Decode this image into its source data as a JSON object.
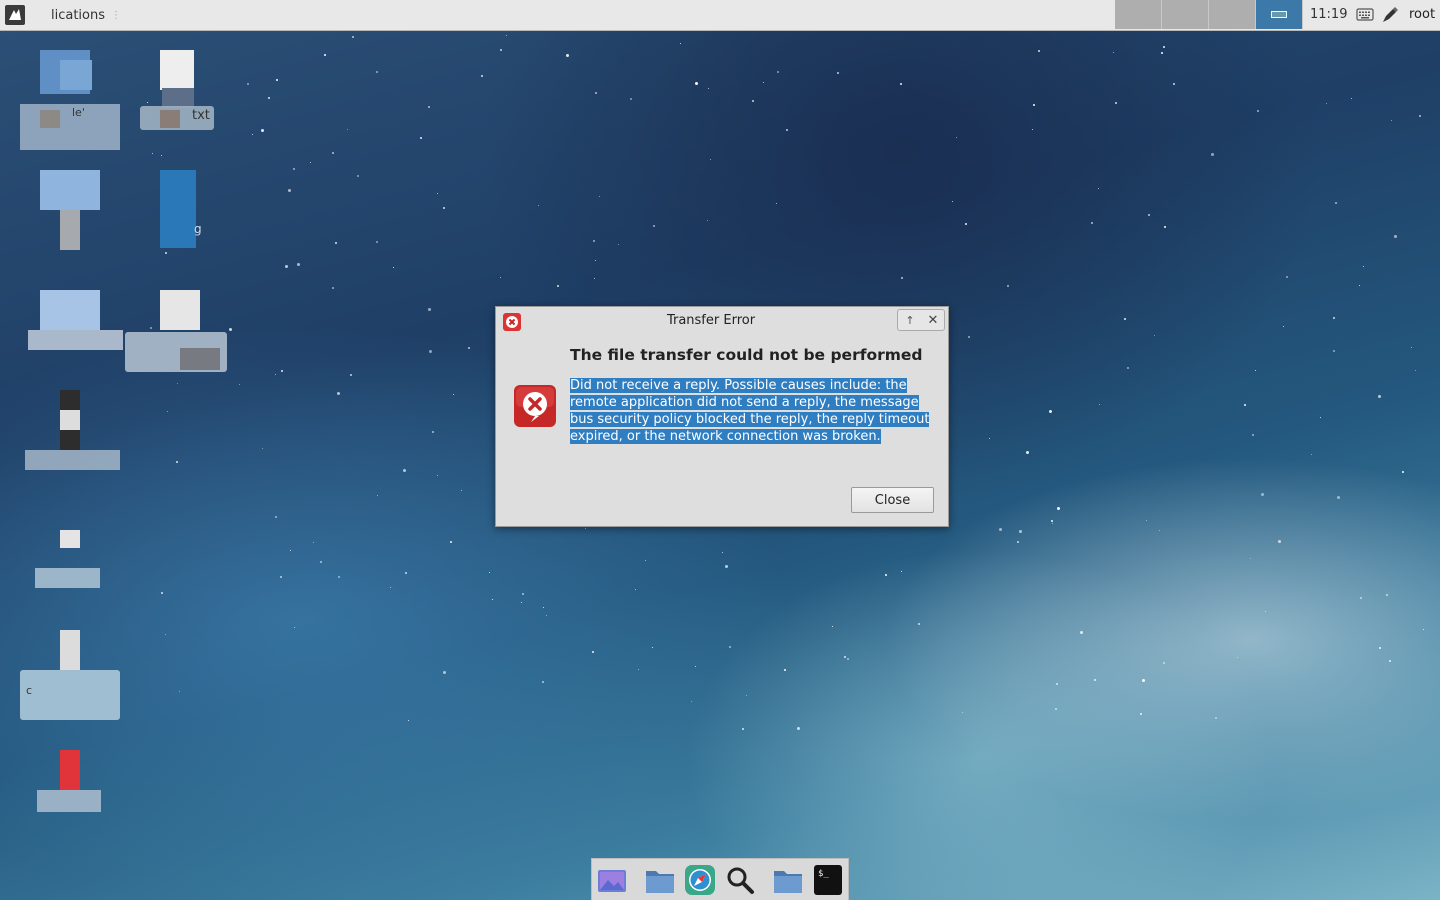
{
  "panel": {
    "applications_label": "lications",
    "separator": "⋮",
    "clock": "11:19",
    "user": "root",
    "workspace_count": 4,
    "active_workspace": 4
  },
  "desktop": {
    "icons": [
      {
        "icon": "folder-link-icon",
        "label": "le'"
      },
      {
        "icon": "text-file-icon",
        "label": "txt"
      },
      {
        "icon": "file-icon",
        "label": ""
      },
      {
        "icon": "image-file-icon",
        "label": "g"
      },
      {
        "icon": "file-icon",
        "label": ""
      },
      {
        "icon": "file-icon",
        "label": ""
      },
      {
        "icon": "file-icon",
        "label": ""
      },
      {
        "icon": "file-icon",
        "label": ""
      },
      {
        "icon": "file-icon",
        "label": "c"
      },
      {
        "icon": "file-icon",
        "label": ""
      }
    ]
  },
  "dialog": {
    "title": "Transfer Error",
    "heading": "The file transfer could not be performed",
    "message": "Did not receive a reply. Possible causes include: the remote application did not send a reply, the message bus security policy blocked the reply, the reply timeout expired, or the network connection was broken.",
    "close_label": "Close",
    "icon": "error-icon",
    "selection_color": "#2f7ec2"
  },
  "dock": {
    "items": [
      {
        "name": "image-viewer-icon"
      },
      {
        "name": "folder-icon"
      },
      {
        "name": "web-browser-icon"
      },
      {
        "name": "search-icon"
      },
      {
        "name": "folder-icon"
      },
      {
        "name": "terminal-icon"
      }
    ]
  }
}
